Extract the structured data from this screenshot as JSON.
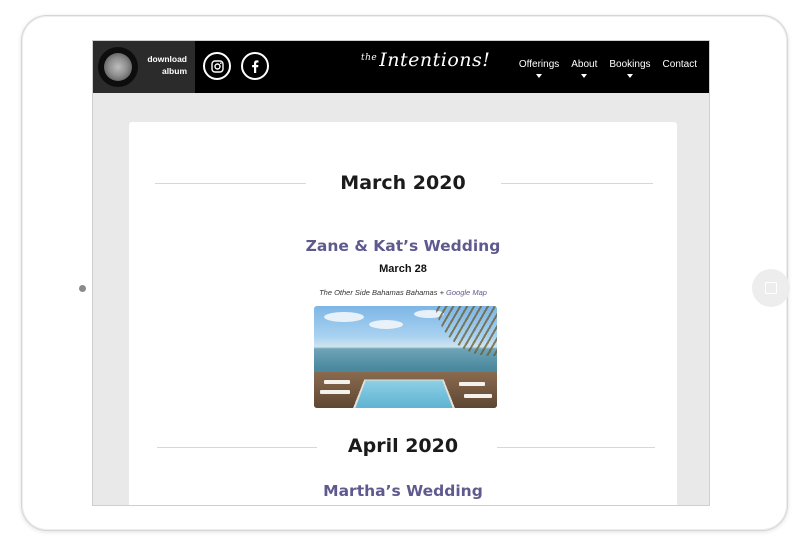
{
  "nav": {
    "album_line1": "download",
    "album_line2": "album",
    "logo_small": "the",
    "logo_main": "Intentions!",
    "menu": [
      {
        "label": "Offerings"
      },
      {
        "label": "About"
      },
      {
        "label": "Bookings"
      },
      {
        "label": "Contact"
      }
    ]
  },
  "sections": [
    {
      "month": "March 2020",
      "event": {
        "title": "Zane & Kat’s Wedding",
        "date": "March 28",
        "location": "The Other Side Bahamas Bahamas",
        "separator": " + ",
        "map_link": "Google Map"
      }
    },
    {
      "month": "April 2020",
      "event": {
        "title": "Martha’s Wedding"
      }
    }
  ],
  "colors": {
    "accent": "#5e5a8e",
    "nav_bg": "#000000",
    "page_bg": "#e9e9e9"
  }
}
